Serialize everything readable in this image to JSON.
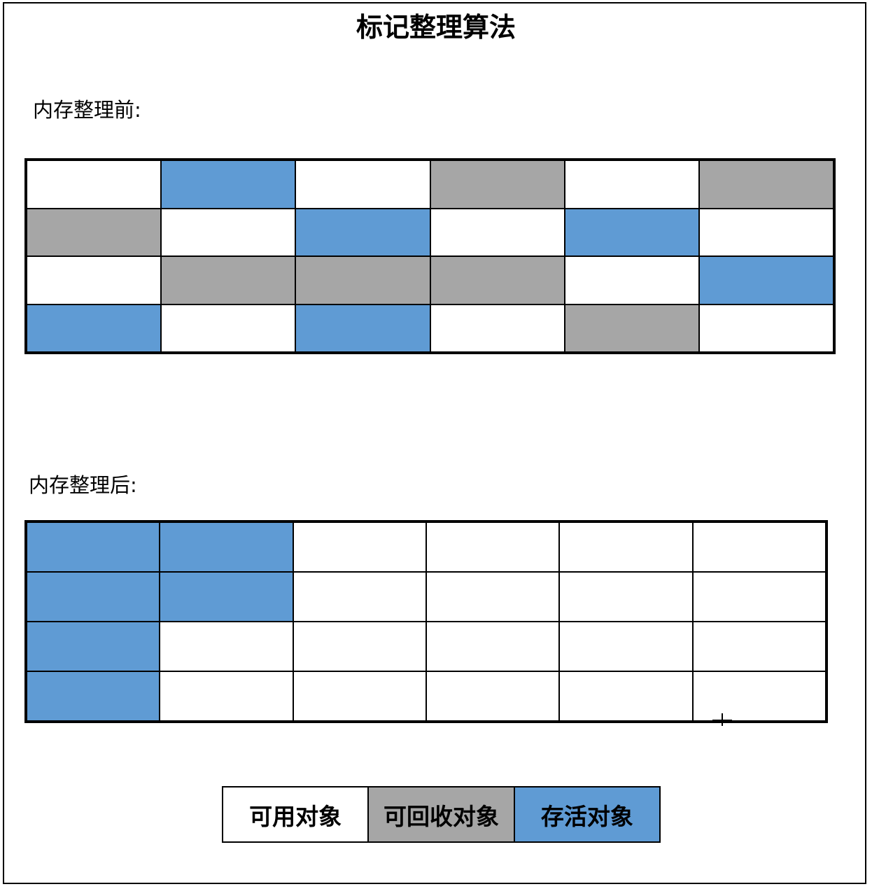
{
  "title": "标记整理算法",
  "before_label": "内存整理前:",
  "after_label": "内存整理后:",
  "colors": {
    "free": "#ffffff",
    "reclaimable": "#a6a6a6",
    "alive": "#5f9bd4",
    "line": "#000000"
  },
  "before_grid": [
    [
      "free",
      "alive",
      "free",
      "reclaimable",
      "free",
      "reclaimable"
    ],
    [
      "reclaimable",
      "free",
      "alive",
      "free",
      "alive",
      "free"
    ],
    [
      "free",
      "reclaimable",
      "reclaimable",
      "reclaimable",
      "free",
      "alive"
    ],
    [
      "alive",
      "free",
      "alive",
      "free",
      "reclaimable",
      "free"
    ]
  ],
  "after_grid": [
    [
      "alive",
      "alive",
      "free",
      "free",
      "free",
      "free"
    ],
    [
      "alive",
      "alive",
      "free",
      "free",
      "free",
      "free"
    ],
    [
      "alive",
      "free",
      "free",
      "free",
      "free",
      "free"
    ],
    [
      "alive",
      "free",
      "free",
      "free",
      "free",
      "free"
    ]
  ],
  "legend": [
    {
      "key": "free",
      "label": "可用对象"
    },
    {
      "key": "reclaimable",
      "label": "可回收对象"
    },
    {
      "key": "alive",
      "label": "存活对象"
    }
  ]
}
